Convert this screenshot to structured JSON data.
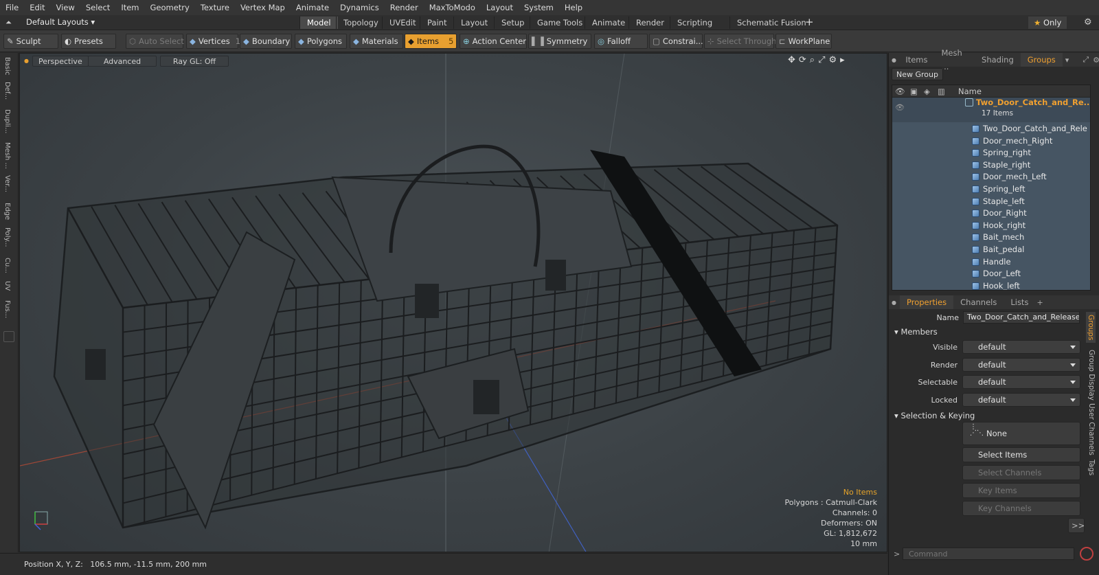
{
  "menubar": {
    "items": [
      "File",
      "Edit",
      "View",
      "Select",
      "Item",
      "Geometry",
      "Texture",
      "Vertex Map",
      "Animate",
      "Dynamics",
      "Render",
      "MaxToModo",
      "Layout",
      "System",
      "Help"
    ]
  },
  "modebar": {
    "layout_label": "Default Layouts",
    "tabs": [
      "Model",
      "Topology",
      "UVEdit",
      "Paint",
      "Layout",
      "Setup",
      "Game Tools",
      "Animate",
      "Render",
      "Scripting",
      "Schematic Fusion"
    ],
    "active_tab": "Model",
    "only_label": "Only"
  },
  "toolbar": {
    "sculpt": "Sculpt",
    "presets": "Presets",
    "auto_select": "Auto Select",
    "vertices": "Vertices",
    "vertices_count": "1",
    "boundary": "Boundary",
    "polygons": "Polygons",
    "materials": "Materials",
    "items": "Items",
    "items_count": "5",
    "action_center": "Action Center",
    "symmetry": "Symmetry",
    "falloff": "Falloff",
    "constraints": "Constrai...",
    "select_through": "Select Through",
    "workplane": "WorkPlane"
  },
  "lefttabs": [
    "Basic",
    "Def...",
    "Dupli...",
    "Mesh ...",
    "Ver...",
    "Edge",
    "Poly...",
    "Cu...",
    "UV",
    "Fus..."
  ],
  "viewport": {
    "view_mode": "Perspective",
    "shading": "Advanced",
    "raygl": "Ray GL: Off",
    "info": {
      "selection": "No Items",
      "polygons": "Polygons : Catmull-Clark",
      "channels": "Channels: 0",
      "deformers": "Deformers: ON",
      "gl": "GL: 1,812,672",
      "scale": "10 mm"
    }
  },
  "statusbar": {
    "position": "Position X, Y, Z:   106.5 mm, -11.5 mm, 200 mm"
  },
  "groups_panel": {
    "tabs": [
      "Items",
      "Mesh ...",
      "Shading",
      "Groups"
    ],
    "active_tab": "Groups",
    "new_group": "New Group",
    "name_header": "Name",
    "group_name": "Two_Door_Catch_and_Re...",
    "group_count": "17 Items",
    "members": [
      "Two_Door_Catch_and_Rele ...",
      "Door_mech_Right",
      "Spring_right",
      "Staple_right",
      "Door_mech_Left",
      "Spring_left",
      "Staple_left",
      "Door_Right",
      "Hook_right",
      "Bait_mech",
      "Bait_pedal",
      "Handle",
      "Door_Left",
      "Hook_left"
    ]
  },
  "properties_panel": {
    "tabs": [
      "Properties",
      "Channels",
      "Lists"
    ],
    "active_tab": "Properties",
    "name_label": "Name",
    "name_value": "Two_Door_Catch_and_Release_A",
    "members_section": "Members",
    "visible_label": "Visible",
    "visible_value": "default",
    "render_label": "Render",
    "render_value": "default",
    "selectable_label": "Selectable",
    "selectable_value": "default",
    "locked_label": "Locked",
    "locked_value": "default",
    "selection_section": "Selection & Keying",
    "none_button": "None",
    "select_items": "Select Items",
    "select_channels": "Select Channels",
    "key_items": "Key Items",
    "key_channels": "Key Channels",
    "more_button": ">>",
    "side_tabs": [
      "Groups",
      "Group Display",
      "User Channels",
      "Tags"
    ]
  },
  "command": {
    "placeholder": "Command"
  },
  "colors": {
    "accent": "#e8a030",
    "group_name": "#f0a030",
    "warning": "#e6a42a"
  }
}
